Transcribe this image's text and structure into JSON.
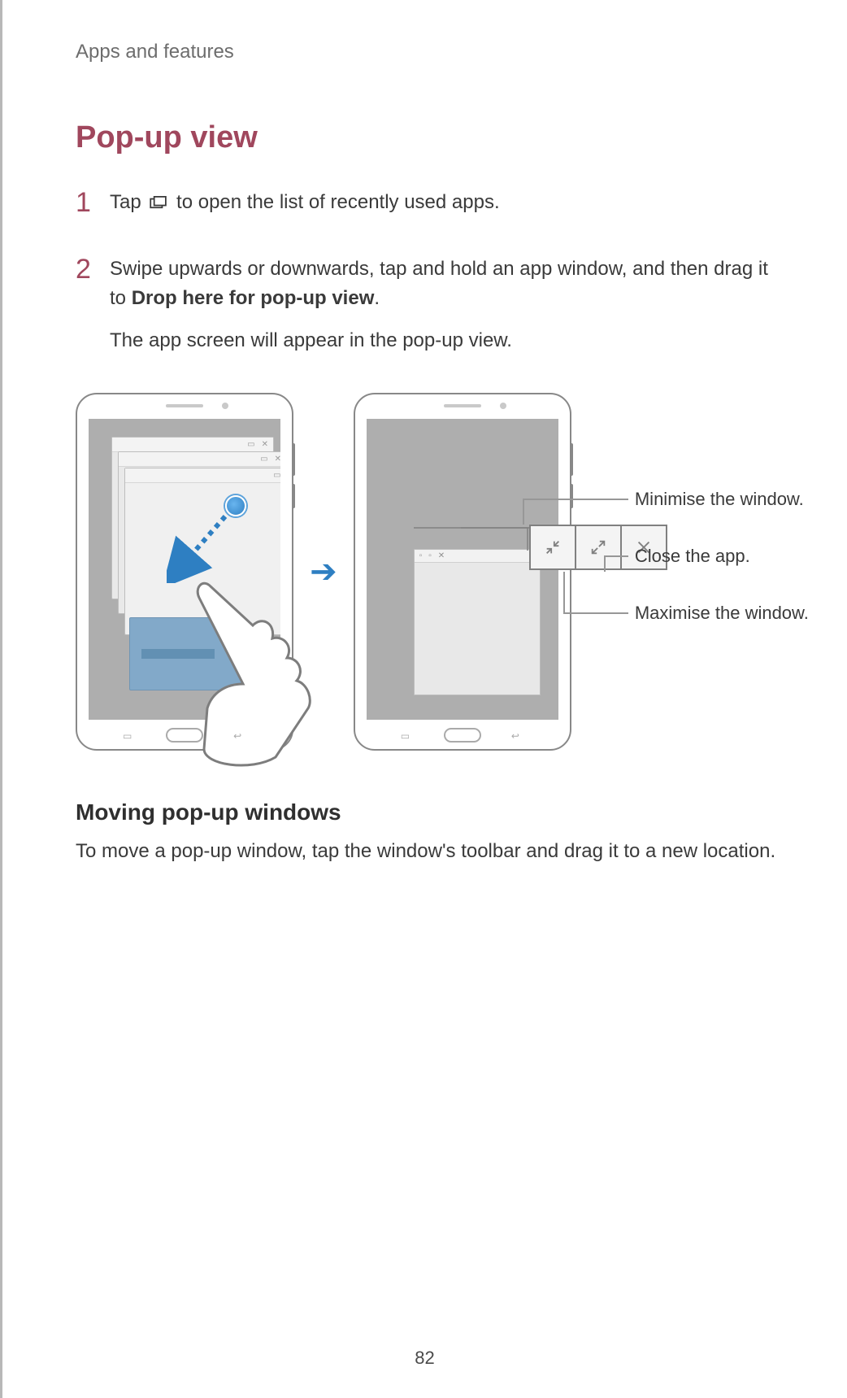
{
  "header": {
    "breadcrumb": "Apps and features"
  },
  "section": {
    "title": "Pop-up view"
  },
  "steps": [
    {
      "num": "1",
      "pre": "Tap ",
      "post": " to open the list of recently used apps."
    },
    {
      "num": "2",
      "line1_a": "Swipe upwards or downwards, tap and hold an app window, and then drag it to ",
      "line1_bold": "Drop here for pop-up view",
      "line1_b": ".",
      "line2": "The app screen will appear in the pop-up view."
    }
  ],
  "callouts": {
    "minimise": "Minimise the window.",
    "close": "Close the app.",
    "maximise": "Maximise the window."
  },
  "subhead": "Moving pop-up windows",
  "body": "To move a pop-up window, tap the window's toolbar and drag it to a new location.",
  "page": "82",
  "icons": {
    "recent": "recent-apps-icon",
    "min": "minimise-icon",
    "max": "maximise-icon",
    "close": "close-icon"
  }
}
